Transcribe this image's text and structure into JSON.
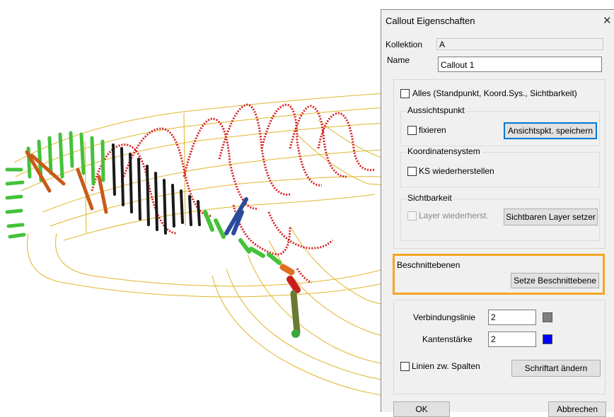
{
  "dialog": {
    "title": "Callout Eigenschaften",
    "close_glyph": "✕",
    "collection_label": "Kollektion",
    "collection_value": "A",
    "name_label": "Name",
    "name_value": "Callout 1",
    "all_checkbox_label": "Alles (Standpunkt, Koord.Sys., Sichtbarkeit)",
    "viewpoint": {
      "legend": "Aussichtspunkt",
      "fix_label": "fixieren",
      "save_button": "Ansichtspkt. speichern"
    },
    "coordinate_system": {
      "legend": "Koordinatensystem",
      "restore_label": "KS wiederherstellen"
    },
    "visibility": {
      "legend": "Sichtbarkeit",
      "layer_restore_label": "Layer wiederherst.",
      "set_layer_button": "Sichtbaren Layer setzer"
    },
    "clipping": {
      "legend": "Beschnittebenen",
      "set_button": "Setze Beschnittebene",
      "highlight_color": "#f5a623"
    },
    "connection_line_label": "Verbindungslinie",
    "connection_line_value": "2",
    "connection_line_color": "#808080",
    "edge_thickness_label": "Kantenstärke",
    "edge_thickness_value": "2",
    "edge_thickness_color": "#0000ff",
    "lines_between_columns_label": "Linien zw. Spalten",
    "change_font_button": "Schriftart ändern",
    "ok_button": "OK",
    "cancel_button": "Abbrechen"
  }
}
